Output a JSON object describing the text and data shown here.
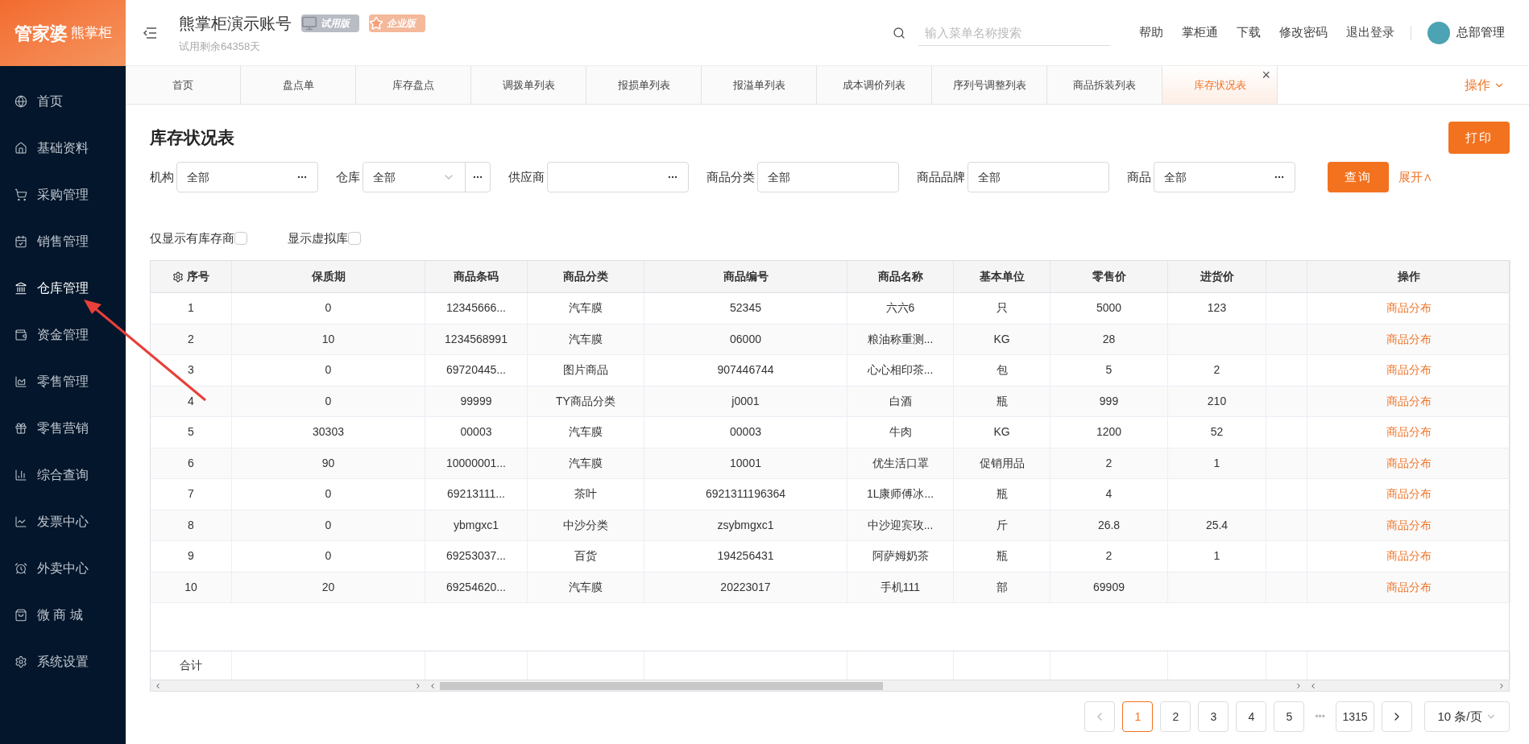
{
  "logo": {
    "main": "管家婆",
    "sub": "熊掌柜"
  },
  "sidebar": {
    "items": [
      {
        "label": "首页",
        "selected": false
      },
      {
        "label": "基础资料",
        "selected": false
      },
      {
        "label": "采购管理",
        "selected": false
      },
      {
        "label": "销售管理",
        "selected": false
      },
      {
        "label": "仓库管理",
        "selected": true
      },
      {
        "label": "资金管理",
        "selected": false
      },
      {
        "label": "零售管理",
        "selected": false
      },
      {
        "label": "零售营销",
        "selected": false
      },
      {
        "label": "综合查询",
        "selected": false
      },
      {
        "label": "发票中心",
        "selected": false
      },
      {
        "label": "外卖中心",
        "selected": false
      },
      {
        "label": "微 商 城",
        "selected": false
      },
      {
        "label": "系统设置",
        "selected": false
      }
    ]
  },
  "header": {
    "account": "熊掌柜演示账号",
    "badges": [
      "试用版",
      "企业版"
    ],
    "trial": "试用剩余64358天",
    "search": {
      "placeholder": "输入菜单名称搜索"
    },
    "links": [
      "帮助",
      "掌柜通",
      "下载",
      "修改密码",
      "退出登录"
    ],
    "user": "总部管理"
  },
  "tabs": {
    "items": [
      {
        "label": "首页",
        "selected": false
      },
      {
        "label": "盘点单",
        "selected": false
      },
      {
        "label": "库存盘点",
        "selected": false
      },
      {
        "label": "调拨单列表",
        "selected": false
      },
      {
        "label": "报损单列表",
        "selected": false
      },
      {
        "label": "报溢单列表",
        "selected": false
      },
      {
        "label": "成本调价列表",
        "selected": false
      },
      {
        "label": "序列号调整列表",
        "selected": false
      },
      {
        "label": "商品拆装列表",
        "selected": false
      },
      {
        "label": "库存状况表",
        "selected": true
      }
    ],
    "close": "×",
    "actions": "操作"
  },
  "page": {
    "title": "库存状况表",
    "print": "打印",
    "query": "查询",
    "expand": "展开∧"
  },
  "filters": [
    {
      "label": "机构",
      "value": "全部",
      "kind": "more"
    },
    {
      "label": "仓库",
      "value": "全部",
      "kind": "select"
    },
    {
      "label": "供应商",
      "kind": "more"
    },
    {
      "label": "商品分类",
      "value": "全部",
      "kind": "plain"
    },
    {
      "label": "商品品牌",
      "value": "全部",
      "kind": "plain"
    },
    {
      "label": "商品",
      "value": "全部",
      "kind": "more"
    }
  ],
  "options": [
    {
      "label": "仅显示有库存商",
      "checked": false
    },
    {
      "label": "显示虚拟库",
      "checked": false
    }
  ],
  "table": {
    "columns": [
      "序号",
      "保质期",
      "商品条码",
      "商品分类",
      "商品编号",
      "商品名称",
      "基本单位",
      "零售价",
      "进货价",
      "",
      "操作"
    ],
    "rows": [
      [
        "1",
        "0",
        "12345666...",
        "汽车膜",
        "52345",
        "六六6",
        "只",
        "5000",
        "123",
        "",
        "商品分布"
      ],
      [
        "2",
        "10",
        "1234568991",
        "汽车膜",
        "06000",
        "粮油称重测...",
        "KG",
        "28",
        "",
        "",
        "商品分布"
      ],
      [
        "3",
        "0",
        "69720445...",
        "图片商品",
        "907446744",
        "心心相印茶...",
        "包",
        "5",
        "2",
        "",
        "商品分布"
      ],
      [
        "4",
        "0",
        "99999",
        "TY商品分类",
        "j0001",
        "白酒",
        "瓶",
        "999",
        "210",
        "",
        "商品分布"
      ],
      [
        "5",
        "30303",
        "00003",
        "汽车膜",
        "00003",
        "牛肉",
        "KG",
        "1200",
        "52",
        "",
        "商品分布"
      ],
      [
        "6",
        "90",
        "10000001...",
        "汽车膜",
        "10001",
        "优生活口罩",
        "促销用品",
        "2",
        "1",
        "",
        "商品分布"
      ],
      [
        "7",
        "0",
        "69213111...",
        "茶叶",
        "6921311196364",
        "1L康师傅冰...",
        "瓶",
        "4",
        "",
        "",
        "商品分布"
      ],
      [
        "8",
        "0",
        "ybmgxc1",
        "中沙分类",
        "zsybmgxc1",
        "中沙迎宾玫...",
        "斤",
        "26.8",
        "25.4",
        "",
        "商品分布"
      ],
      [
        "9",
        "0",
        "69253037...",
        "百货",
        "194256431",
        "阿萨姆奶茶",
        "瓶",
        "2",
        "1",
        "",
        "商品分布"
      ],
      [
        "10",
        "20",
        "69254620...",
        "汽车膜",
        "20223017",
        "手机111",
        "部",
        "69909",
        "",
        "",
        "商品分布"
      ]
    ],
    "total_label": "合计"
  },
  "pagination": {
    "pages": [
      {
        "label": "1",
        "selected": true
      },
      {
        "label": "2",
        "selected": false
      },
      {
        "label": "3",
        "selected": false
      },
      {
        "label": "4",
        "selected": false
      },
      {
        "label": "5",
        "selected": false
      }
    ],
    "ellipsis": "•••",
    "last": "1315",
    "page_size": "10 条/页"
  }
}
